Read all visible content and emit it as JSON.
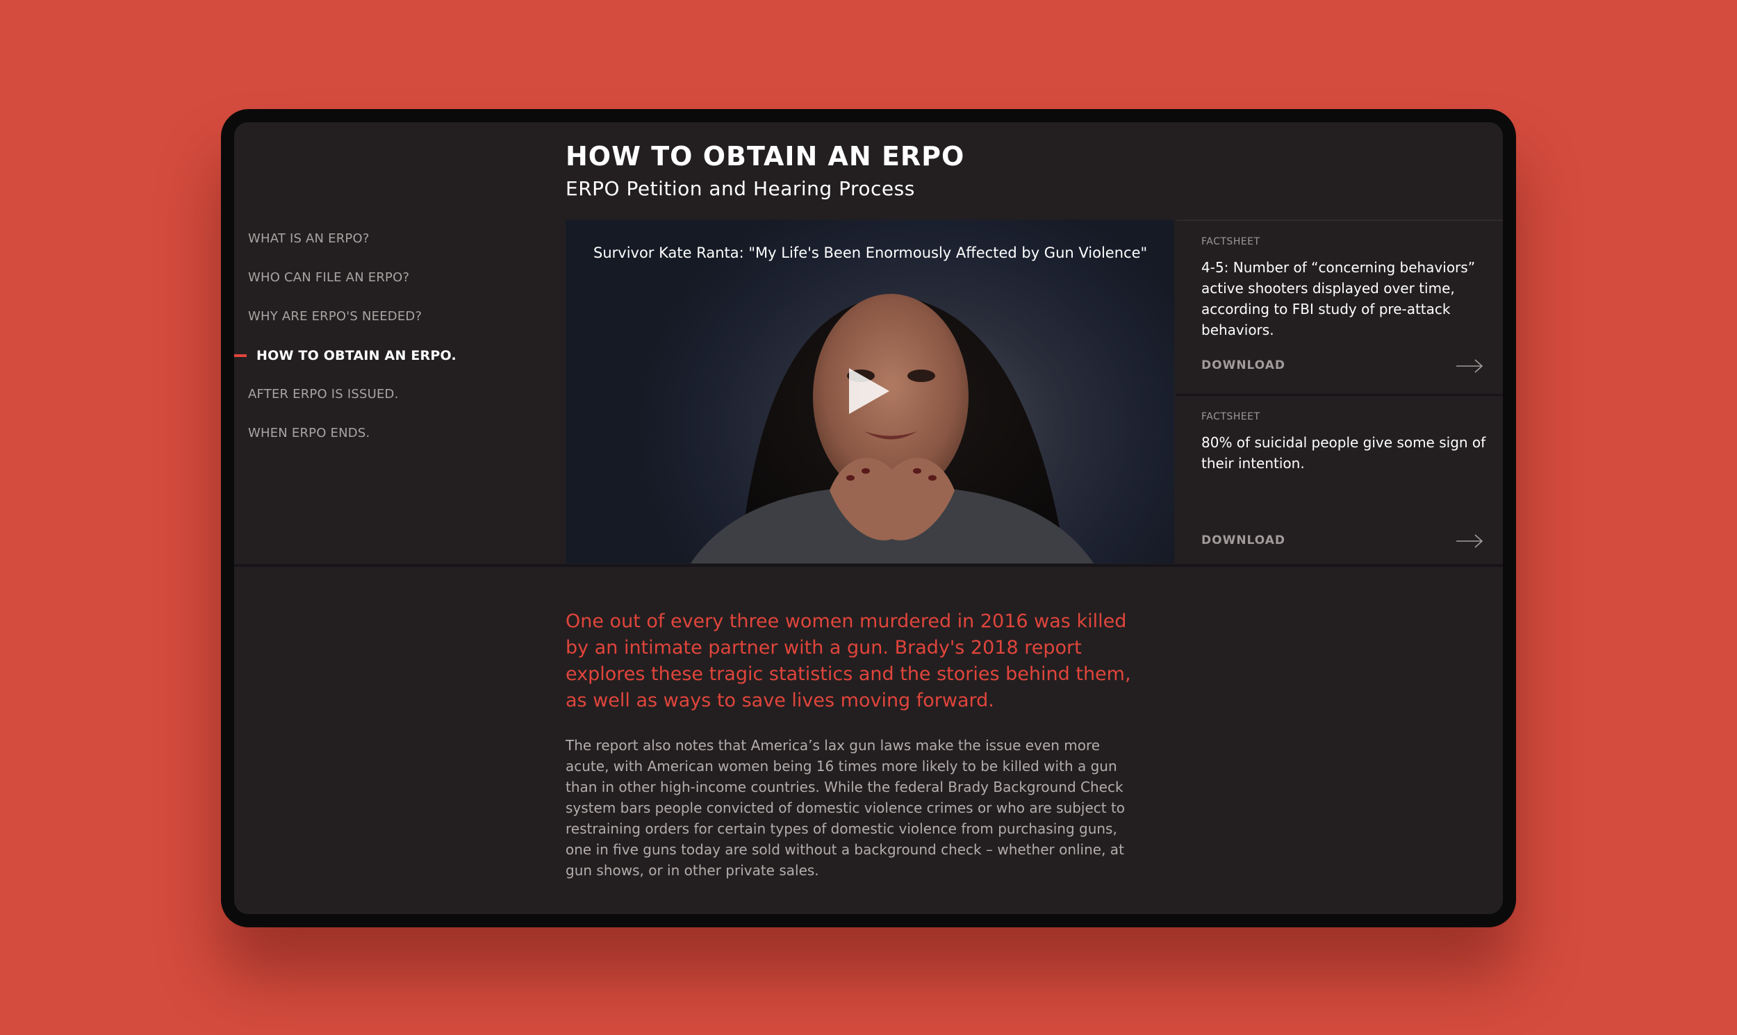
{
  "nav": {
    "items": [
      {
        "label": "What is an ERPO?"
      },
      {
        "label": "Who can file an ERPO?"
      },
      {
        "label": "Why are ERPO's needed?"
      },
      {
        "label": "How to obtain an ERPO."
      },
      {
        "label": "After ERPO is issued."
      },
      {
        "label": "When ERPO ends."
      }
    ],
    "active_index": 3
  },
  "header": {
    "title": "HOW TO OBTAIN AN ERPO",
    "subtitle": "ERPO Petition and Hearing Process"
  },
  "video": {
    "caption": "Survivor Kate Ranta: \"My Life's Been Enormously Affected by Gun Violence\""
  },
  "factsheets": [
    {
      "label": "FACTSHEET",
      "text": "4-5: Number of “concerning behaviors” active shooters displayed over time, according to FBI study of pre-attack behaviors.",
      "download_label": "DOWNLOAD"
    },
    {
      "label": "FACTSHEET",
      "text": "80% of suicidal people give some sign of their intention.",
      "download_label": "DOWNLOAD"
    }
  ],
  "article": {
    "lead": "One out of every three women murdered in 2016 was killed by an intimate partner with a gun. Brady's 2018 report explores these tragic statistics and the stories behind them, as well as ways to save lives moving forward.",
    "body": "The report also notes that America’s lax gun laws make the issue even more acute, with American women being 16 times more likely to be killed with a gun than in other high-income countries. While the federal Brady Background Check system bars people convicted of domestic violence crimes or who are subject to restraining orders for certain types of domestic violence from purchasing guns, one in five guns today are sold without a background check – whether online, at gun shows, or in other private sales."
  },
  "colors": {
    "background": "#d44c3e",
    "screen": "#231f20",
    "accent": "#e0453c"
  }
}
